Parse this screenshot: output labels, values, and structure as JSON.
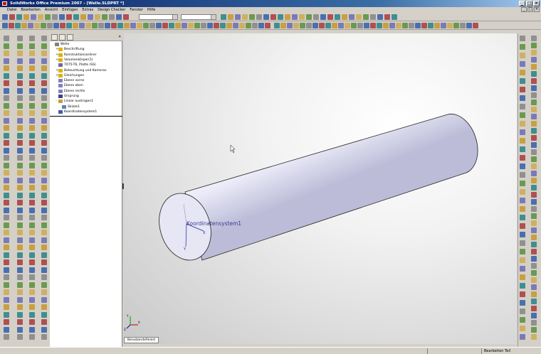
{
  "window": {
    "title": "SolidWorks Office Premium 2007 - [Welle.SLDPRT *]"
  },
  "menus": [
    "Datei",
    "Bearbeiten",
    "Ansicht",
    "Einfügen",
    "Extras",
    "Design Checker",
    "Fenster",
    "Hilfe"
  ],
  "feature_tree": {
    "items": [
      {
        "label": "Welle",
        "indent": 0,
        "expand": "",
        "icon": "part-icon",
        "color": "#808080"
      },
      {
        "label": "Beschriftung",
        "indent": 1,
        "expand": "+",
        "icon": "annotation-folder-icon",
        "color": "#e0b000"
      },
      {
        "label": "Konstruktionsordner",
        "indent": 1,
        "expand": "+",
        "icon": "design-binder-icon",
        "color": "#e0b000"
      },
      {
        "label": "Volumenkörper(1)",
        "indent": 1,
        "expand": "+",
        "icon": "solid-bodies-folder-icon",
        "color": "#e0b000"
      },
      {
        "label": "7075-T6, Platte (SS)",
        "indent": 1,
        "expand": "",
        "icon": "material-icon",
        "color": "#6a6aa0"
      },
      {
        "label": "Beleuchtung und Kameras",
        "indent": 1,
        "expand": "+",
        "icon": "lights-folder-icon",
        "color": "#e0b000"
      },
      {
        "label": "Gleichungen",
        "indent": 1,
        "expand": "+",
        "icon": "equations-folder-icon",
        "color": "#e0b000"
      },
      {
        "label": "Ebene vorne",
        "indent": 1,
        "expand": "",
        "icon": "plane-icon",
        "color": "#8080c0"
      },
      {
        "label": "Ebene oben",
        "indent": 1,
        "expand": "",
        "icon": "plane-icon",
        "color": "#8080c0"
      },
      {
        "label": "Ebene rechts",
        "indent": 1,
        "expand": "",
        "icon": "plane-icon",
        "color": "#8080c0"
      },
      {
        "label": "Ursprung",
        "indent": 1,
        "expand": "",
        "icon": "origin-icon",
        "color": "#404080"
      },
      {
        "label": "Linear austragen1",
        "indent": 1,
        "expand": "-",
        "icon": "extrude-feature-icon",
        "color": "#c0a040"
      },
      {
        "label": "Skizze1",
        "indent": 2,
        "expand": "",
        "icon": "sketch-icon",
        "color": "#6080c0"
      },
      {
        "label": "Koordinatensystem1",
        "indent": 1,
        "expand": "",
        "icon": "coordinate-system-icon",
        "color": "#4060a0"
      }
    ]
  },
  "viewport": {
    "annotation_label": "Koordinatensystem1",
    "triad": {
      "x": "X",
      "y": "Y",
      "z": "Z"
    },
    "cylinder_color": "#e4e4f6",
    "cylinder_edge_color": "#202020"
  },
  "model_tab": {
    "label": "Benutzerdefiniert"
  },
  "status": {
    "right": "Bearbeiten Teil"
  }
}
